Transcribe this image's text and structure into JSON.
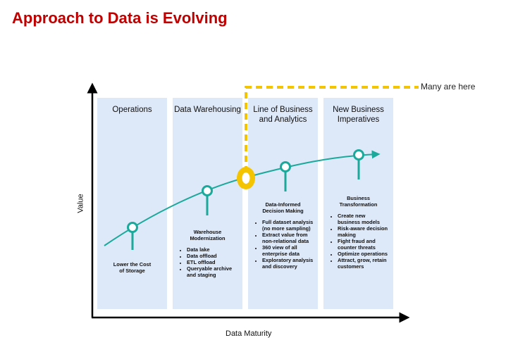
{
  "title": "Approach to Data is Evolving",
  "axes": {
    "x_label": "Data Maturity",
    "y_label": "Value"
  },
  "threshold_label": "Many are here",
  "colors": {
    "title": "#c00000",
    "column_bg": "#dde8f8",
    "curve": "#1aa99a",
    "threshold": "#f4c400"
  },
  "columns": [
    {
      "title": "Operations",
      "heading": "Lower the Cost of Storage",
      "bullets": []
    },
    {
      "title": "Data Warehousing",
      "heading": "Warehouse Modernization",
      "bullets": [
        "Data lake",
        "Data offload",
        "ETL offload",
        "Queryable archive and staging"
      ]
    },
    {
      "title": "Line of Business and Analytics",
      "heading": "Data-Informed Decision Making",
      "bullets": [
        "Full dataset analysis (no more sampling)",
        "Extract value from non-relational data",
        "360 view of all enterprise data",
        "Exploratory analysis and discovery"
      ]
    },
    {
      "title": "New Business Imperatives",
      "heading": "Business Transformation",
      "bullets": [
        "Create new business models",
        "Risk-aware decision making",
        "Fight fraud and counter threats",
        "Optimize operations",
        "Attract, grow, retain customers"
      ]
    }
  ]
}
